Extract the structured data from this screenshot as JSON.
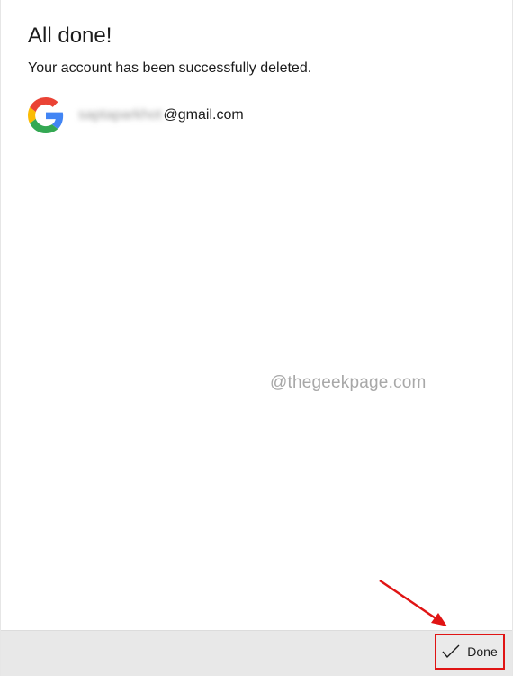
{
  "dialog": {
    "title": "All done!",
    "message": "Your account has been successfully deleted."
  },
  "account": {
    "provider_icon": "google-logo-icon",
    "email_user_redacted": "saptaparkhot",
    "email_domain": "@gmail.com"
  },
  "watermark": {
    "text": "@thegeekpage.com"
  },
  "footer": {
    "done_label": "Done",
    "done_icon": "check-icon"
  },
  "annotation": {
    "arrow_color": "#e01414",
    "highlight_color": "#e01414"
  }
}
